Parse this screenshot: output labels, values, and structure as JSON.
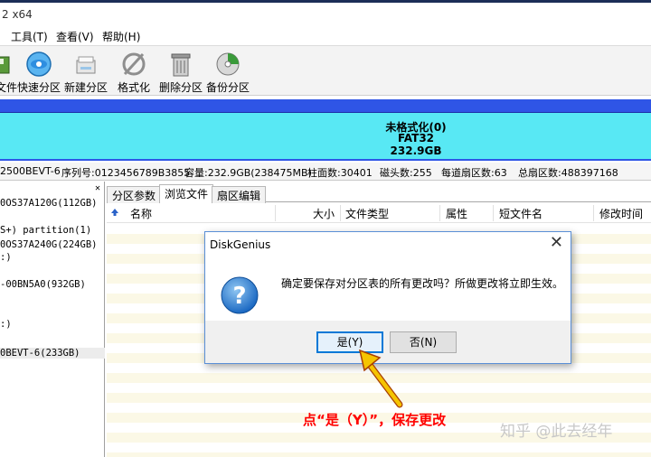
{
  "window": {
    "title": "2 x64"
  },
  "menu": {
    "tools": "工具(T)",
    "view": "查看(V)",
    "help": "帮助(H)"
  },
  "toolbar": {
    "items": [
      {
        "label": "文件",
        "icon": "save-disk-icon"
      },
      {
        "label": "快速分区",
        "icon": "quick-partition-icon"
      },
      {
        "label": "新建分区",
        "icon": "new-partition-icon"
      },
      {
        "label": "格式化",
        "icon": "format-icon"
      },
      {
        "label": "删除分区",
        "icon": "delete-partition-icon"
      },
      {
        "label": "备份分区",
        "icon": "backup-partition-icon"
      }
    ]
  },
  "disk_bar": {
    "line1": "未格式化(0)",
    "line2": "FAT32",
    "line3": "232.9GB"
  },
  "disk_info": {
    "model": "2500BEVT-6",
    "serial": "序列号:0123456789B3855",
    "capacity": "容量:232.9GB(238475MB)",
    "cylinders": "柱面数:30401",
    "heads": "磁头数:255",
    "sectors_per_track": "每道扇区数:63",
    "total_sectors": "总扇区数:488397168"
  },
  "tree": {
    "items": [
      "0OS37A120G(112GB)",
      "S+) partition(1)",
      "0OS37A240G(224GB)",
      ":)",
      "-00BN5A0(932GB)",
      ":)",
      "0BEVT-6(233GB)"
    ]
  },
  "tabs": {
    "partition_params": "分区参数",
    "browse_files": "浏览文件",
    "sector_edit": "扇区编辑"
  },
  "columns": {
    "name": "名称",
    "size": "大小",
    "file_type": "文件类型",
    "attributes": "属性",
    "short_name": "短文件名",
    "modified": "修改时间"
  },
  "dialog": {
    "title": "DiskGenius",
    "message": "确定要保存对分区表的所有更改吗？所做更改将立即生效。",
    "yes_label": "是(Y)",
    "no_label": "否(N)"
  },
  "annotation": {
    "text": "点“是（Y）”，保存更改"
  },
  "watermark": {
    "text": "知乎 @此去经年"
  },
  "colors": {
    "accent": "#2f55e6",
    "disk_fill": "#58e8f4",
    "annotation": "#ff0000",
    "arrow": "#f5c400"
  }
}
